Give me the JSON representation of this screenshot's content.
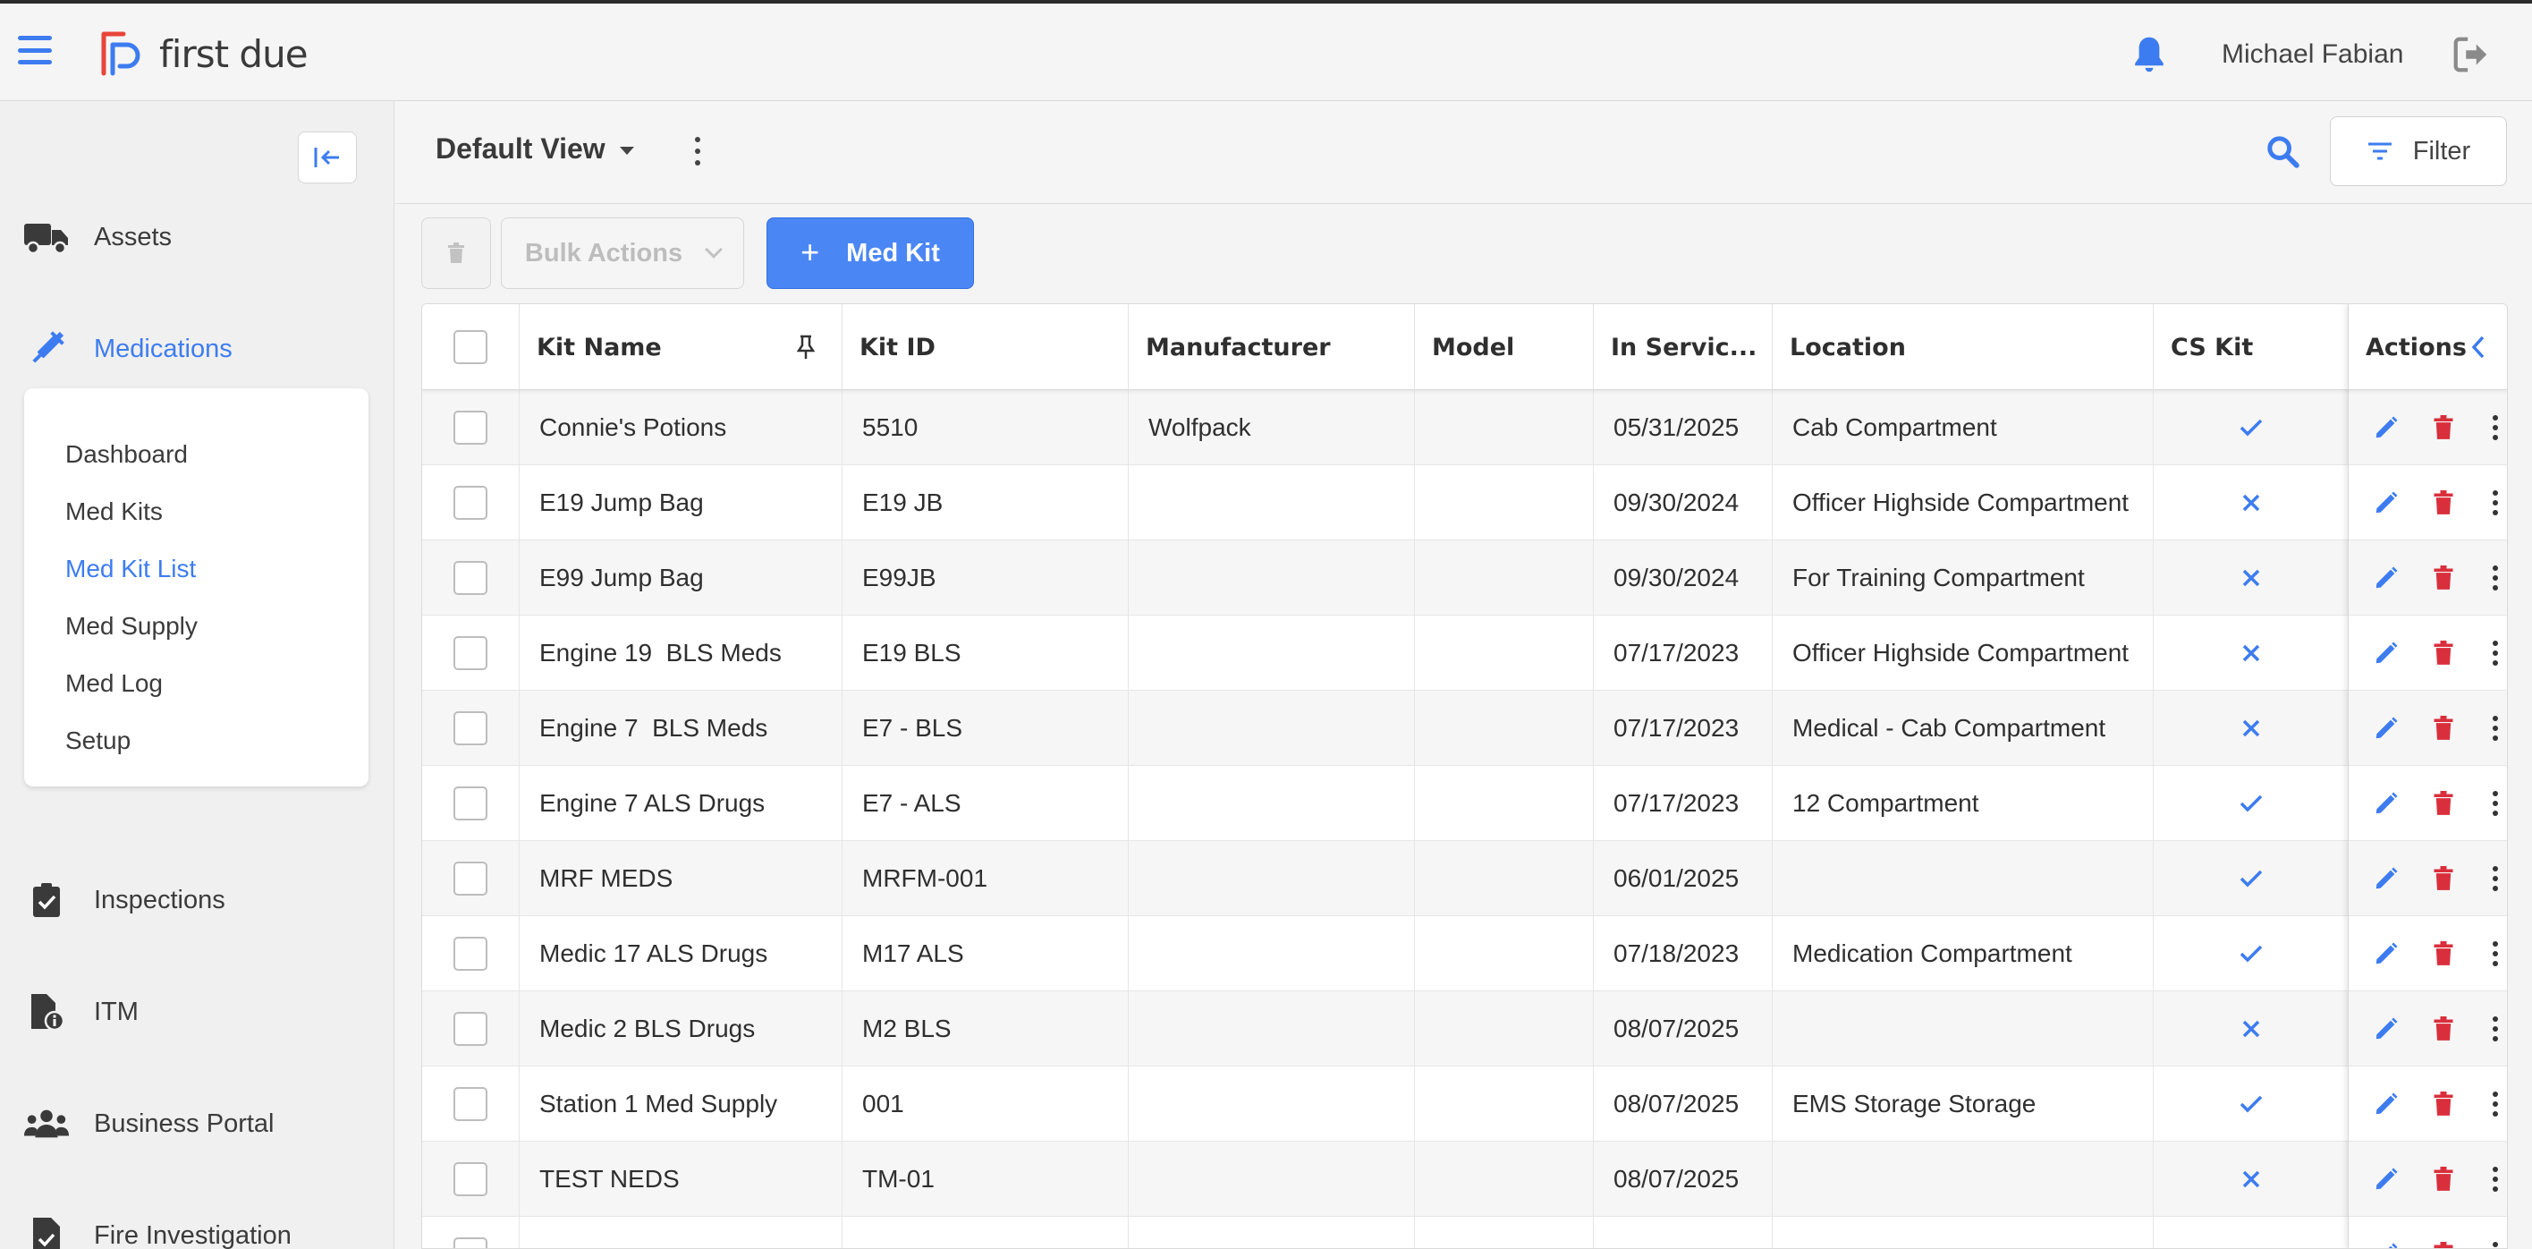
{
  "app": {
    "brand": "first due",
    "user_name": "Michael Fabian",
    "accent_color": "#3d7cf0",
    "brand_red": "#e8443a"
  },
  "sidebar": {
    "items": [
      {
        "label": "Assets",
        "icon": "truck-icon"
      },
      {
        "label": "Medications",
        "icon": "syringe-icon",
        "active": true
      },
      {
        "label": "Inspections",
        "icon": "clipboard-check-icon"
      },
      {
        "label": "ITM",
        "icon": "file-info-icon"
      },
      {
        "label": "Business Portal",
        "icon": "people-icon"
      },
      {
        "label": "Fire Investigation",
        "icon": "file-check-icon"
      }
    ],
    "submenu": [
      "Dashboard",
      "Med Kits",
      "Med Kit List",
      "Med Supply",
      "Med Log",
      "Setup"
    ],
    "submenu_active": "Med Kit List"
  },
  "viewbar": {
    "view_name": "Default View",
    "filter_label": "Filter"
  },
  "toolbar": {
    "bulk_actions_label": "Bulk Actions",
    "add_label": "Med Kit"
  },
  "table": {
    "columns": [
      "Kit Name",
      "Kit ID",
      "Manufacturer",
      "Model",
      "In Servic...",
      "Location",
      "CS Kit",
      "Actions"
    ],
    "rows": [
      {
        "kit_name": "Connie's Potions",
        "kit_id": "5510",
        "manufacturer": "Wolfpack",
        "model": "",
        "in_service": "05/31/2025",
        "location": "Cab Compartment",
        "cs_kit": true
      },
      {
        "kit_name": "E19 Jump Bag",
        "kit_id": "E19 JB",
        "manufacturer": "",
        "model": "",
        "in_service": "09/30/2024",
        "location": "Officer Highside Compartment",
        "cs_kit": false
      },
      {
        "kit_name": "E99 Jump Bag",
        "kit_id": "E99JB",
        "manufacturer": "",
        "model": "",
        "in_service": "09/30/2024",
        "location": "For Training Compartment",
        "cs_kit": false
      },
      {
        "kit_name": "Engine 19  BLS Meds",
        "kit_id": "E19 BLS",
        "manufacturer": "",
        "model": "",
        "in_service": "07/17/2023",
        "location": "Officer Highside Compartment",
        "cs_kit": false
      },
      {
        "kit_name": "Engine 7  BLS Meds",
        "kit_id": "E7 - BLS",
        "manufacturer": "",
        "model": "",
        "in_service": "07/17/2023",
        "location": "Medical - Cab Compartment",
        "cs_kit": false
      },
      {
        "kit_name": "Engine 7 ALS Drugs",
        "kit_id": "E7 - ALS",
        "manufacturer": "",
        "model": "",
        "in_service": "07/17/2023",
        "location": "12 Compartment",
        "cs_kit": true
      },
      {
        "kit_name": "MRF MEDS",
        "kit_id": "MRFM-001",
        "manufacturer": "",
        "model": "",
        "in_service": "06/01/2025",
        "location": "",
        "cs_kit": true
      },
      {
        "kit_name": "Medic 17 ALS Drugs",
        "kit_id": "M17 ALS",
        "manufacturer": "",
        "model": "",
        "in_service": "07/18/2023",
        "location": "Medication Compartment",
        "cs_kit": true
      },
      {
        "kit_name": "Medic 2 BLS Drugs",
        "kit_id": "M2 BLS",
        "manufacturer": "",
        "model": "",
        "in_service": "08/07/2025",
        "location": "",
        "cs_kit": false
      },
      {
        "kit_name": "Station 1 Med Supply",
        "kit_id": "001",
        "manufacturer": "",
        "model": "",
        "in_service": "08/07/2025",
        "location": "EMS Storage Storage",
        "cs_kit": true
      },
      {
        "kit_name": "TEST NEDS",
        "kit_id": "TM-01",
        "manufacturer": "",
        "model": "",
        "in_service": "08/07/2025",
        "location": "",
        "cs_kit": false
      }
    ]
  }
}
